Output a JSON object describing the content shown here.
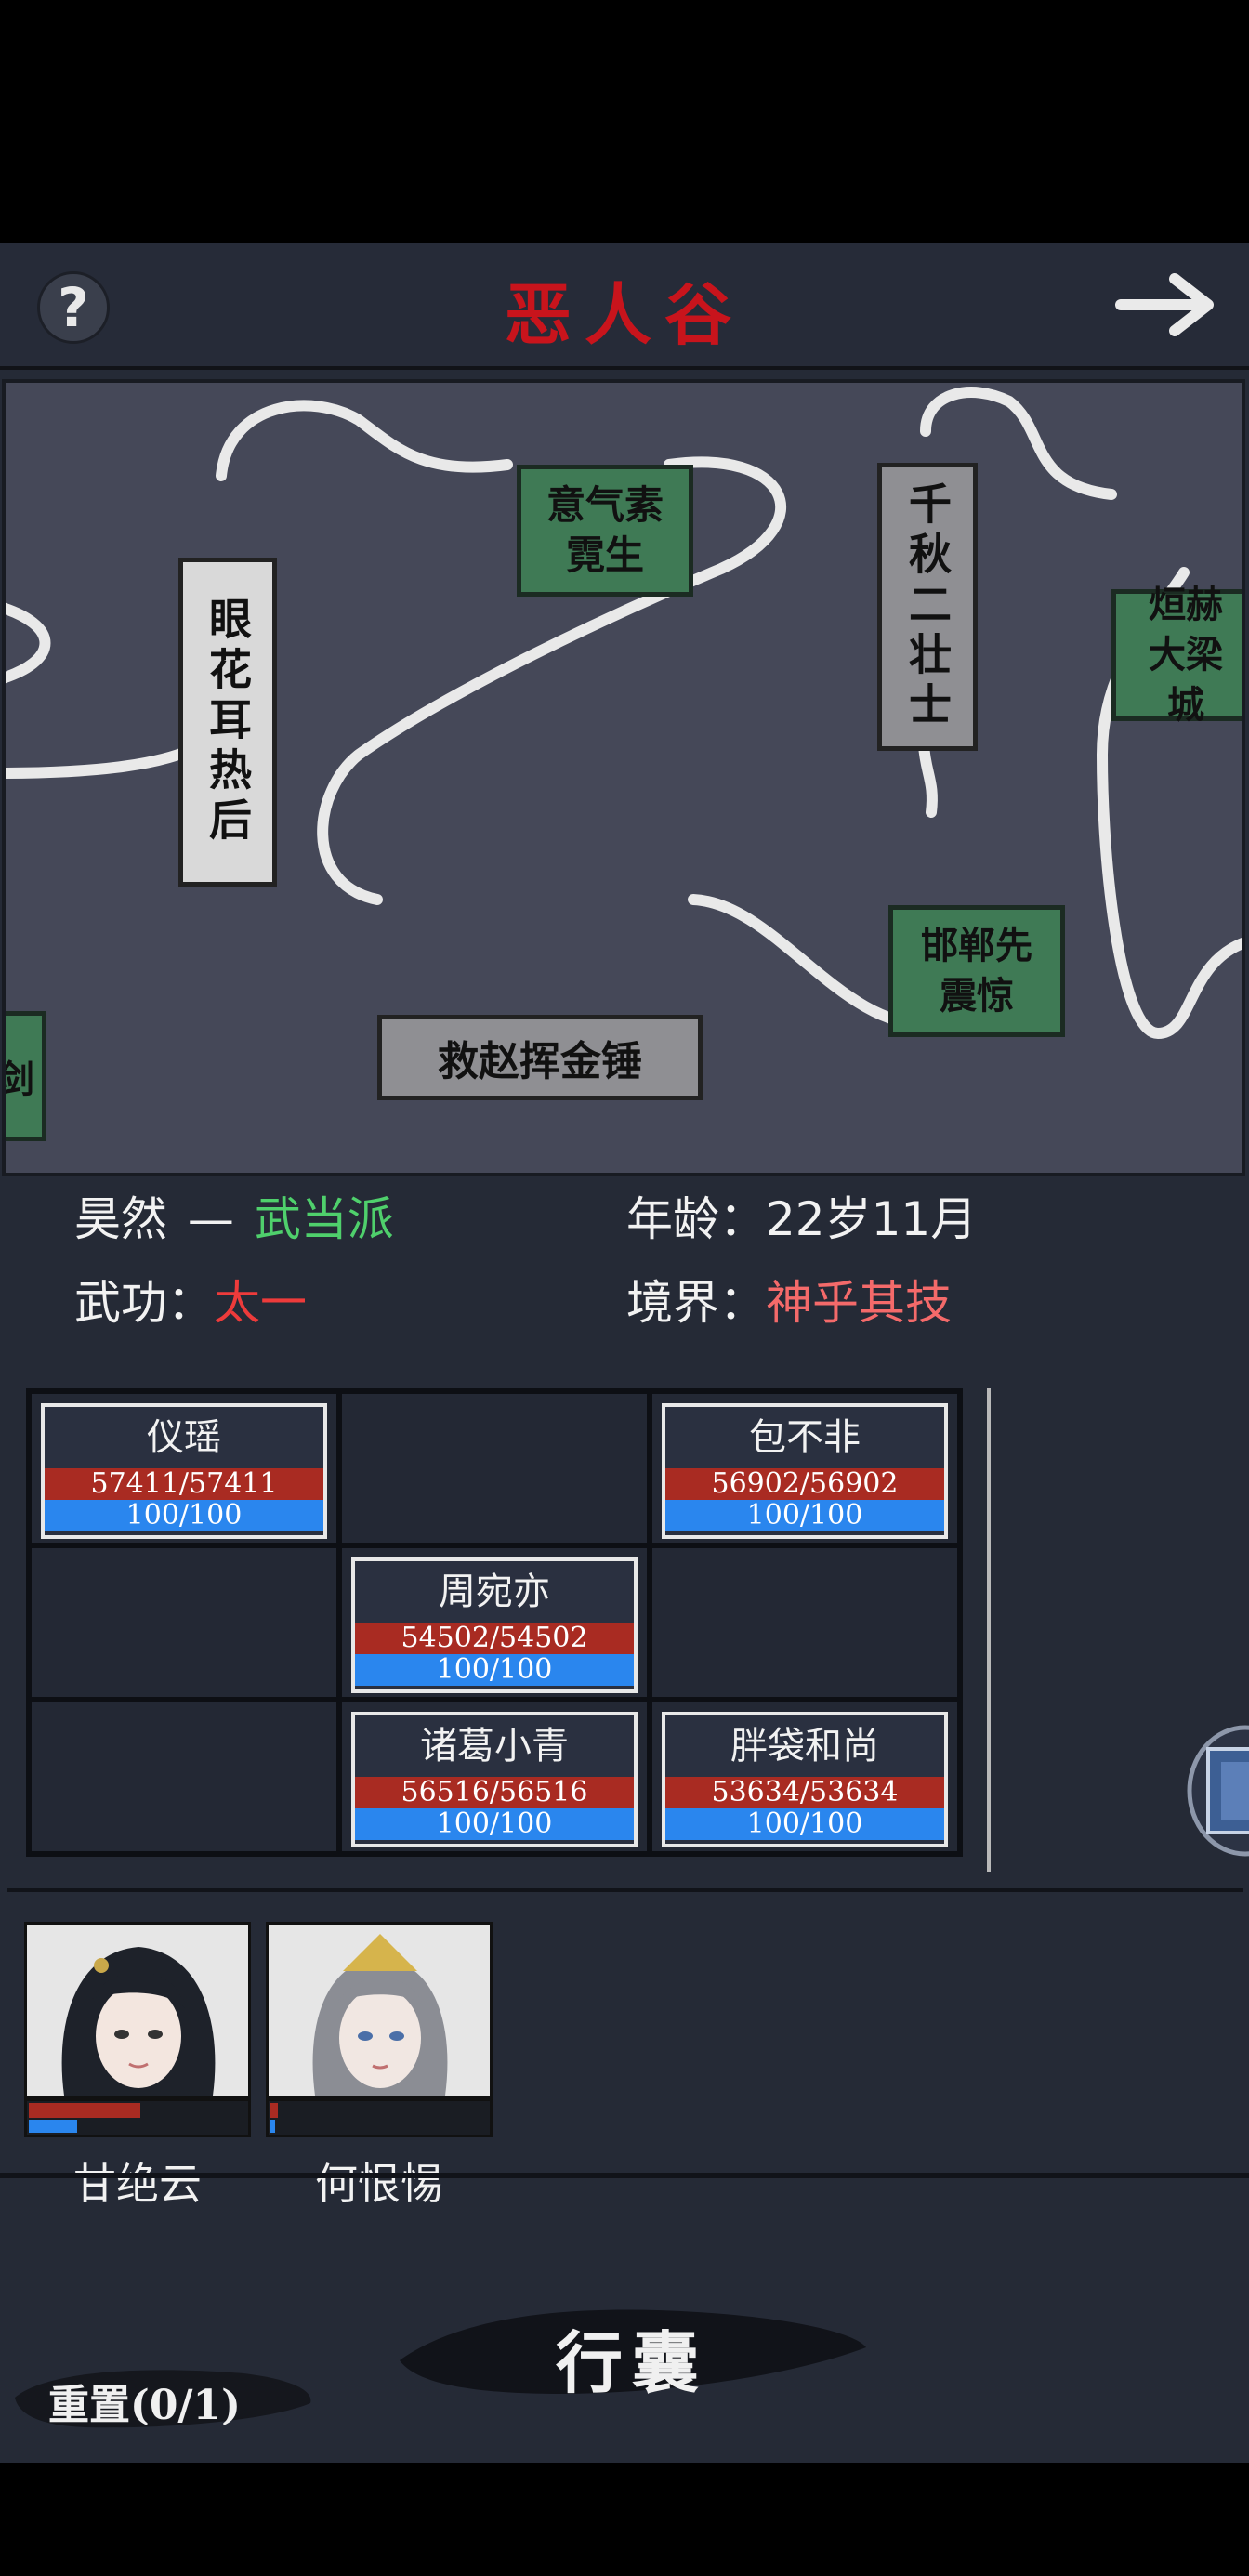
{
  "header": {
    "title": "恶人谷",
    "help_icon": "?"
  },
  "map": {
    "nodes": [
      {
        "label": "眼花耳热后"
      },
      {
        "label": "意气素霓生"
      },
      {
        "label": "千秋二壮士"
      },
      {
        "label": "烜赫大梁城"
      },
      {
        "label": "邯郸先震惊"
      },
      {
        "label": "救赵挥金锤"
      },
      {
        "label": "剑"
      }
    ]
  },
  "player": {
    "name": "昊然",
    "separator": "—",
    "sect": "武当派",
    "age_label": "年龄：",
    "age_value": "22岁11月",
    "skill_label": "武功：",
    "skill_value": "太一",
    "realm_label": "境界：",
    "realm_value": "神乎其技",
    "sect_color": "#4fd06c",
    "skill_color": "#ee3b3b",
    "realm_color": "#f46a6a"
  },
  "formation": [
    {
      "name": "仪瑶",
      "hp": "57411/57411",
      "mp": "100/100"
    },
    {
      "name": "包不非",
      "hp": "56902/56902",
      "mp": "100/100"
    },
    {
      "name": "周宛亦",
      "hp": "54502/54502",
      "mp": "100/100"
    },
    {
      "name": "诸葛小青",
      "hp": "56516/56516",
      "mp": "100/100"
    },
    {
      "name": "胖袋和尚",
      "hp": "53634/53634",
      "mp": "100/100"
    }
  ],
  "party": [
    {
      "name": "甘绝云",
      "hp_fraction": 0.5,
      "mp_fraction": 0.22
    },
    {
      "name": "何恨惕",
      "hp_fraction": 0.03,
      "mp_fraction": 0.02
    }
  ],
  "bottom": {
    "bag_label": "行囊",
    "reset_label": "重置(0/1)"
  }
}
